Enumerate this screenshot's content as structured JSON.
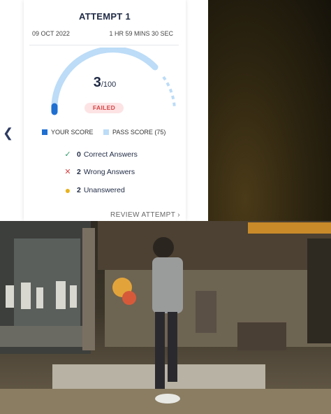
{
  "attempt": {
    "title": "ATTEMPT 1",
    "date": "09 OCT 2022",
    "duration": "1 HR 59 MINS 30 SEC",
    "score": "3",
    "total": "/100",
    "score_fraction": 0.03,
    "pass_fraction": 0.75,
    "status": "FAILED",
    "legend": {
      "your_score": "YOUR SCORE",
      "pass_score": "PASS SCORE (75)"
    },
    "stats": [
      {
        "count": "0",
        "label": "Correct Answers",
        "icon": "check-icon"
      },
      {
        "count": "2",
        "label": "Wrong Answers",
        "icon": "cross-icon"
      },
      {
        "count": "2",
        "label": "Unanswered",
        "icon": "dot-icon"
      }
    ],
    "review_label": "REVIEW ATTEMPT"
  },
  "colors": {
    "navy": "#1f2a44",
    "your_score": "#1f6fd1",
    "pass_score": "#bcdcf7",
    "failed_bg": "#fde3e4",
    "failed_text": "#d64545",
    "correct": "#2e9b6a",
    "wrong": "#d64545",
    "unanswered": "#e8b21e"
  }
}
